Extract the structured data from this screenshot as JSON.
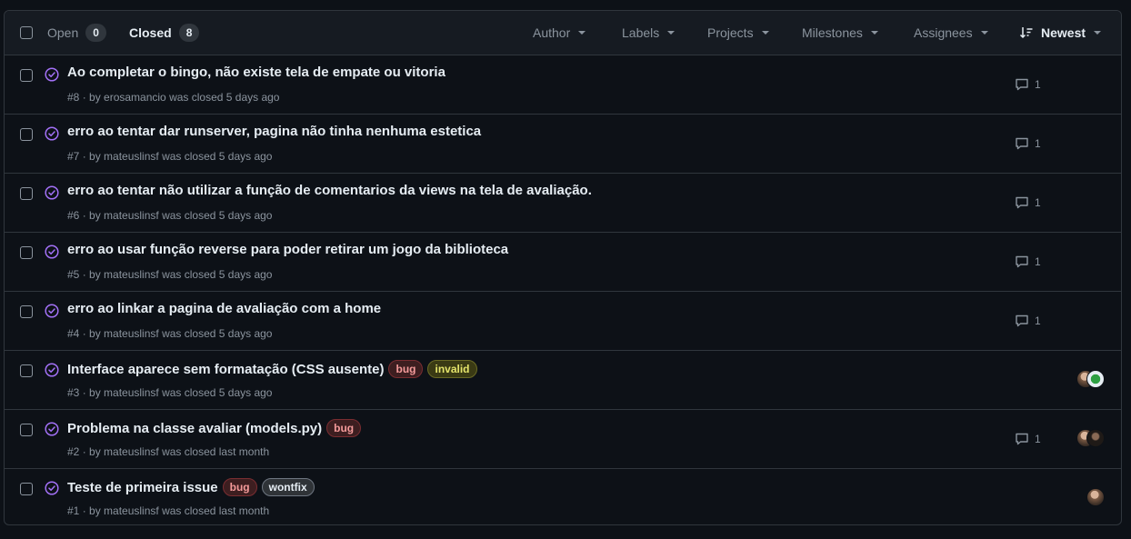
{
  "header": {
    "open_label": "Open",
    "open_count": "0",
    "closed_label": "Closed",
    "closed_count": "8",
    "filters": [
      "Author",
      "Labels",
      "Projects",
      "Milestones",
      "Assignees"
    ],
    "sort_label": "Newest"
  },
  "colors": {
    "closed_icon": "#a371f7",
    "bug": "#f49a9a",
    "invalid": "#e4e46b",
    "wontfix": "#e6edf3"
  },
  "issues": [
    {
      "title": "Ao completar o bingo, não existe tela de empate ou vitoria",
      "number": "#8",
      "by": " · by ",
      "author": "erosamancio",
      "closed_text": " was closed 5 days ago",
      "comments": "1",
      "labels": [],
      "avatars": []
    },
    {
      "title": "erro ao tentar dar runserver, pagina não tinha nenhuma estetica",
      "number": "#7",
      "by": " · by ",
      "author": "mateuslinsf",
      "closed_text": " was closed 5 days ago",
      "comments": "1",
      "labels": [],
      "avatars": []
    },
    {
      "title": "erro ao tentar não utilizar a função de comentarios da views na tela de avaliação.",
      "number": "#6",
      "by": " · by ",
      "author": "mateuslinsf",
      "closed_text": " was closed 5 days ago",
      "comments": "1",
      "labels": [],
      "avatars": []
    },
    {
      "title": "erro ao usar função reverse para poder retirar um jogo da biblioteca",
      "number": "#5",
      "by": " · by ",
      "author": "mateuslinsf",
      "closed_text": " was closed 5 days ago",
      "comments": "1",
      "labels": [],
      "avatars": []
    },
    {
      "title": "erro ao linkar a pagina de avaliação com a home",
      "number": "#4",
      "by": " · by ",
      "author": "mateuslinsf",
      "closed_text": " was closed 5 days ago",
      "comments": "1",
      "labels": [],
      "avatars": []
    },
    {
      "title": "Interface aparece sem formatação (CSS ausente)",
      "number": "#3",
      "by": " · by ",
      "author": "mateuslinsf",
      "closed_text": " was closed 5 days ago",
      "comments": "",
      "labels": [
        "bug",
        "invalid"
      ],
      "avatars": [
        "avatar-photo",
        "avatar-green-logo"
      ]
    },
    {
      "title": "Problema na classe avaliar (models.py)",
      "number": "#2",
      "by": " · by ",
      "author": "mateuslinsf",
      "closed_text": " was closed last month",
      "comments": "1",
      "labels": [
        "bug"
      ],
      "avatars": [
        "avatar-photo",
        "avatar-photo-dark"
      ]
    },
    {
      "title": "Teste de primeira issue",
      "number": "#1",
      "by": " · by ",
      "author": "mateuslinsf",
      "closed_text": " was closed last month",
      "comments": "",
      "labels": [
        "bug",
        "wontfix"
      ],
      "avatars": [
        "avatar-photo"
      ]
    }
  ]
}
